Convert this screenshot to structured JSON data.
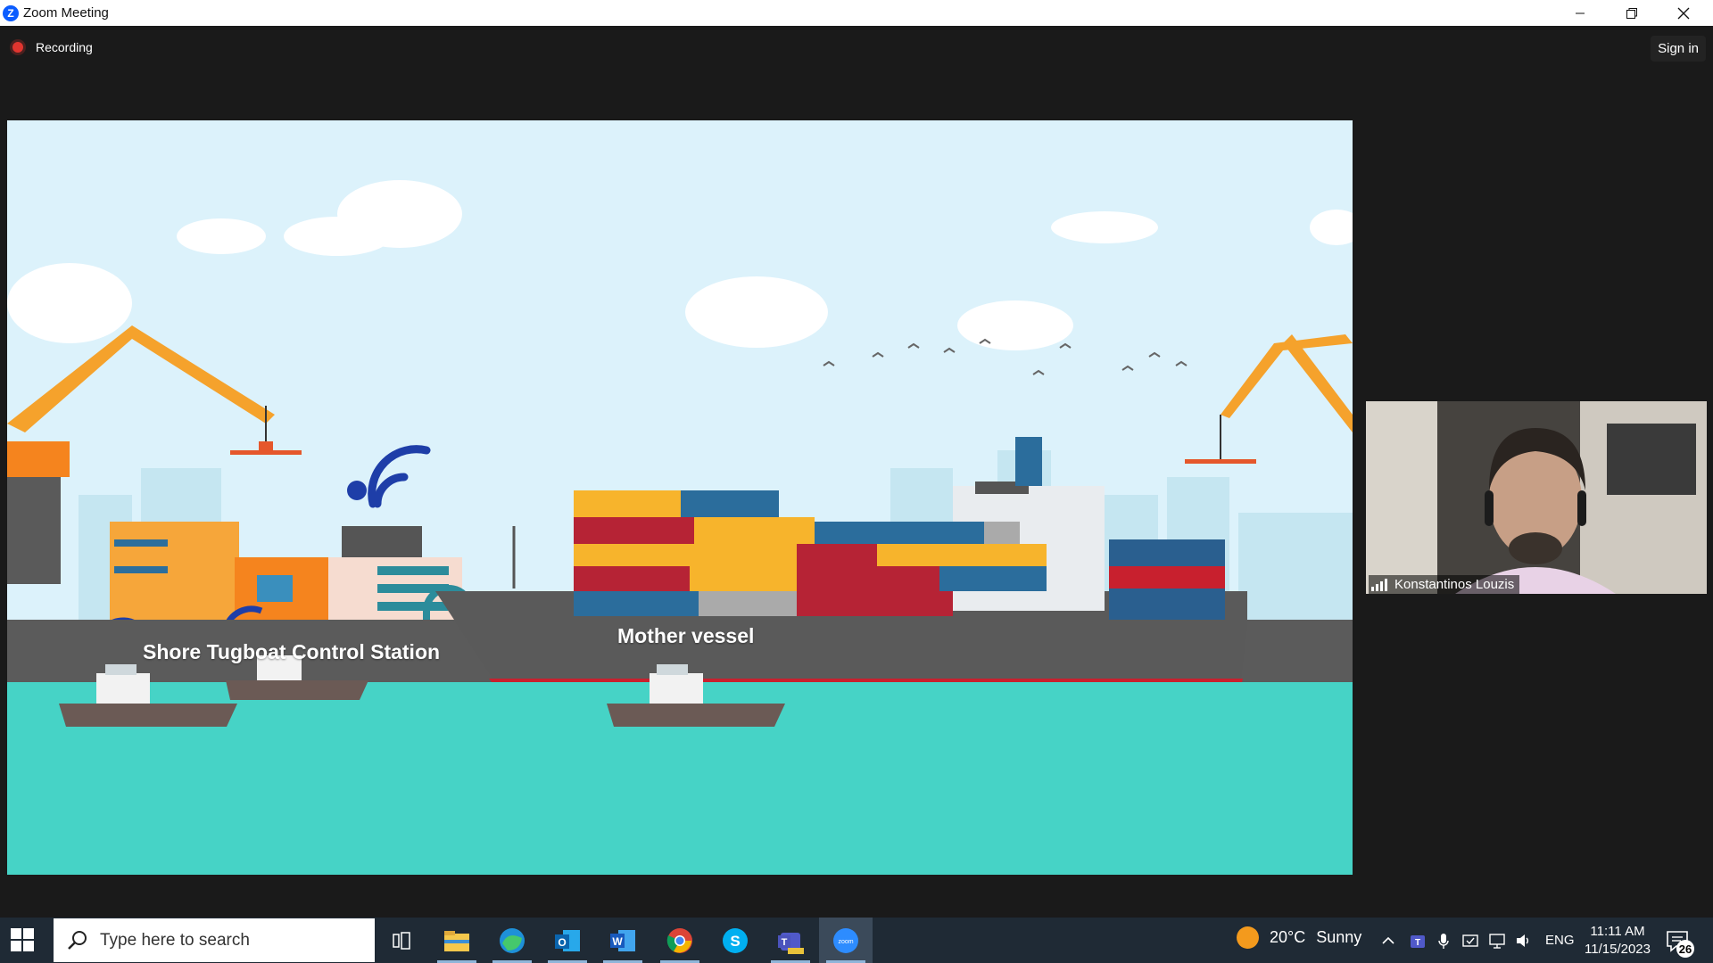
{
  "window": {
    "title": "Zoom Meeting",
    "app_icon": "zoom-logo-icon"
  },
  "meeting": {
    "recording_label": "Recording",
    "sign_in_label": "Sign in",
    "shared_content": {
      "labels": [
        "Shore Tugboat Control Station",
        "Mother vessel"
      ]
    },
    "participant": {
      "name": "Konstantinos Louzis"
    }
  },
  "taskbar": {
    "search_placeholder": "Type here to search",
    "pinned_icons": [
      "task-view-icon",
      "file-explorer-icon",
      "edge-icon",
      "outlook-icon",
      "word-icon",
      "chrome-icon",
      "skype-icon",
      "teams-icon",
      "zoom-icon"
    ],
    "weather": {
      "temp": "20°C",
      "condition": "Sunny"
    },
    "language": "ENG",
    "time": "11:11 AM",
    "date": "11/15/2023",
    "notification_count": "26"
  },
  "colors": {
    "zoom_blue": "#0b5cff",
    "recording_red": "#e0352f",
    "taskbar": "#1f2a35",
    "sea": "#46d3c6",
    "ship_hull_red": "#c8202e"
  }
}
